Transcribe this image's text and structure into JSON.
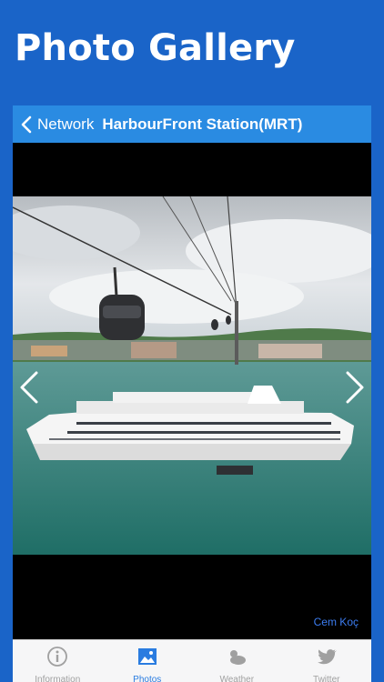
{
  "promo": {
    "title": "Photo Gallery"
  },
  "navbar": {
    "back_label": "Network",
    "title": "HarbourFront Station(MRT)"
  },
  "photo": {
    "credit": "Cem Koç"
  },
  "tabs": [
    {
      "label": "Information",
      "icon": "info-icon"
    },
    {
      "label": "Photos",
      "icon": "photos-icon",
      "selected": true
    },
    {
      "label": "Weather",
      "icon": "weather-icon"
    },
    {
      "label": "Twitter",
      "icon": "twitter-icon"
    }
  ],
  "colors": {
    "background": "#1a64c8",
    "navbar": "#2a8be2",
    "tab_active": "#2a7ce0",
    "tab_inactive": "#a0a0a0",
    "credit": "#3b7cf0"
  }
}
